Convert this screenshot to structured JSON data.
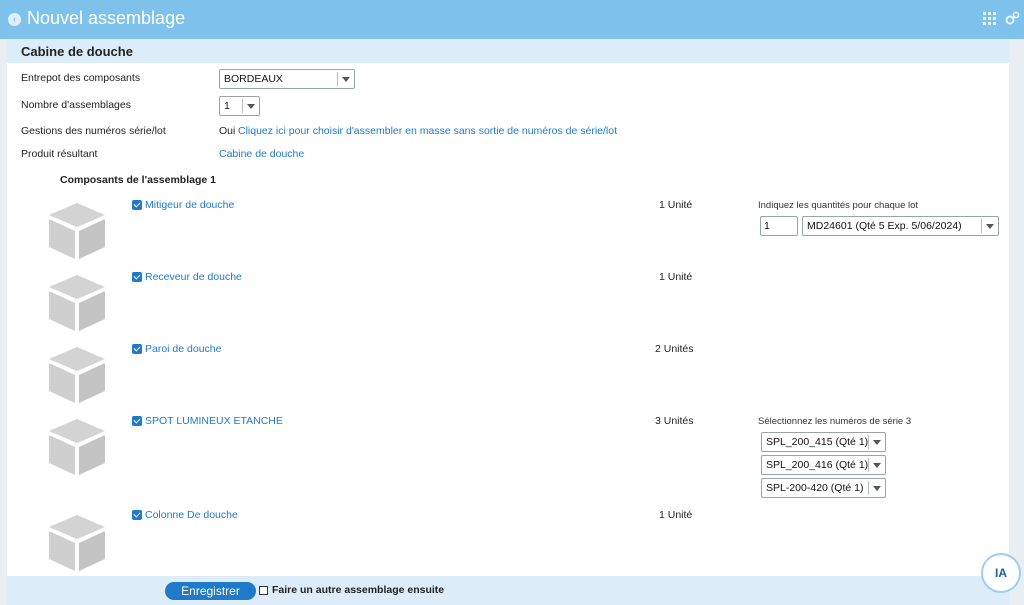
{
  "header": {
    "title": "Nouvel assemblage",
    "back_icon": "back-arrow-icon",
    "apps_icon": "grid-icon",
    "settings_icon": "gears-icon"
  },
  "section": {
    "title": "Cabine de douche"
  },
  "form": {
    "warehouse_label": "Entrepot des composants",
    "warehouse_value": "BORDEAUX",
    "count_label": "Nombre d'assemblages",
    "count_value": "1",
    "serial_label": "Gestions des numéros série/lot",
    "serial_value": "Oui",
    "serial_link": "Cliquez ici pour choisir d'assembler en masse sans sortie de numéros de série/lot",
    "product_label": "Produit résultant",
    "product_value": "Cabine de douche"
  },
  "components": {
    "title": "Composants de l'assemblage 1",
    "items": [
      {
        "name": "Mitigeur de douche",
        "qty": "1 Unité",
        "checked": true
      },
      {
        "name": "Receveur de douche",
        "qty": "1 Unité",
        "checked": true
      },
      {
        "name": "Paroi de douche",
        "qty": "2 Unités",
        "checked": true
      },
      {
        "name": "SPOT LUMINEUX ETANCHE",
        "qty": "3 Unités",
        "checked": true
      },
      {
        "name": "Colonne De douche",
        "qty": "1 Unité",
        "checked": true
      }
    ],
    "lot": {
      "label": "Indiquez les quantités pour chaque lot",
      "qty": "1",
      "value": "MD24601 (Qté 5 Exp. 5/06/2024)"
    },
    "serials": {
      "label": "Sélectionnez les numéros de série 3",
      "values": [
        "SPL_200_415 (Qté 1)",
        "SPL_200_416 (Qté 1)",
        "SPL-200-420 (Qté 1)"
      ]
    }
  },
  "footer": {
    "save_label": "Enregistrer",
    "another_label": "Faire un autre assemblage ensuite"
  },
  "ia": {
    "label": "IA"
  },
  "colors": {
    "accent": "#1f7ac8",
    "topbar": "#7ec2ec",
    "section_bg": "#dcecf8"
  }
}
